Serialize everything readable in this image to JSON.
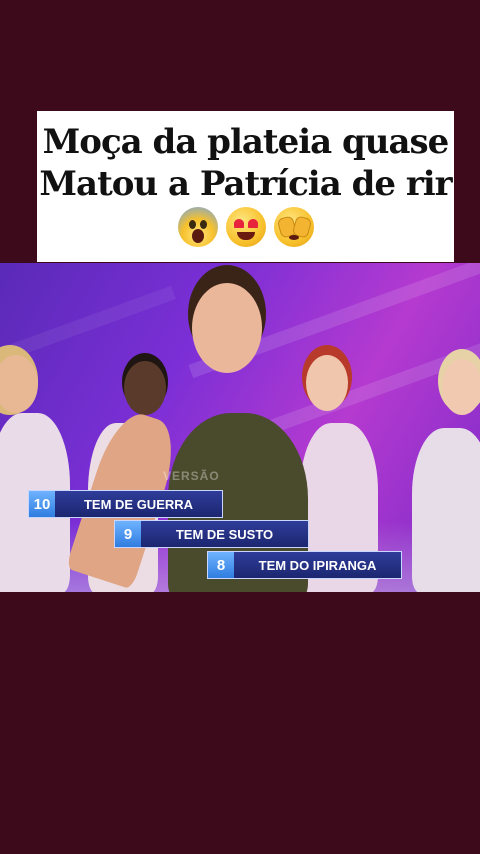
{
  "caption": {
    "line1": "Moça da plateia quase",
    "line2": "Matou a Patrícia de rir",
    "emojis": [
      "face-screaming-in-fear-icon",
      "smiling-face-with-heart-eyes-icon",
      "face-with-peeking-eye-icon"
    ]
  },
  "video": {
    "watermark": "VERSÃO",
    "ranking": [
      {
        "rank": "10",
        "label": "TEM DE GUERRA"
      },
      {
        "rank": "9",
        "label": "TEM DE SUSTO"
      },
      {
        "rank": "8",
        "label": "TEM DO IPIRANGA"
      }
    ]
  },
  "colors": {
    "background": "#3d0a1c",
    "caption_bg": "#ffffff",
    "bar_label": "#1c2670",
    "bar_number": "#2f7de0"
  }
}
